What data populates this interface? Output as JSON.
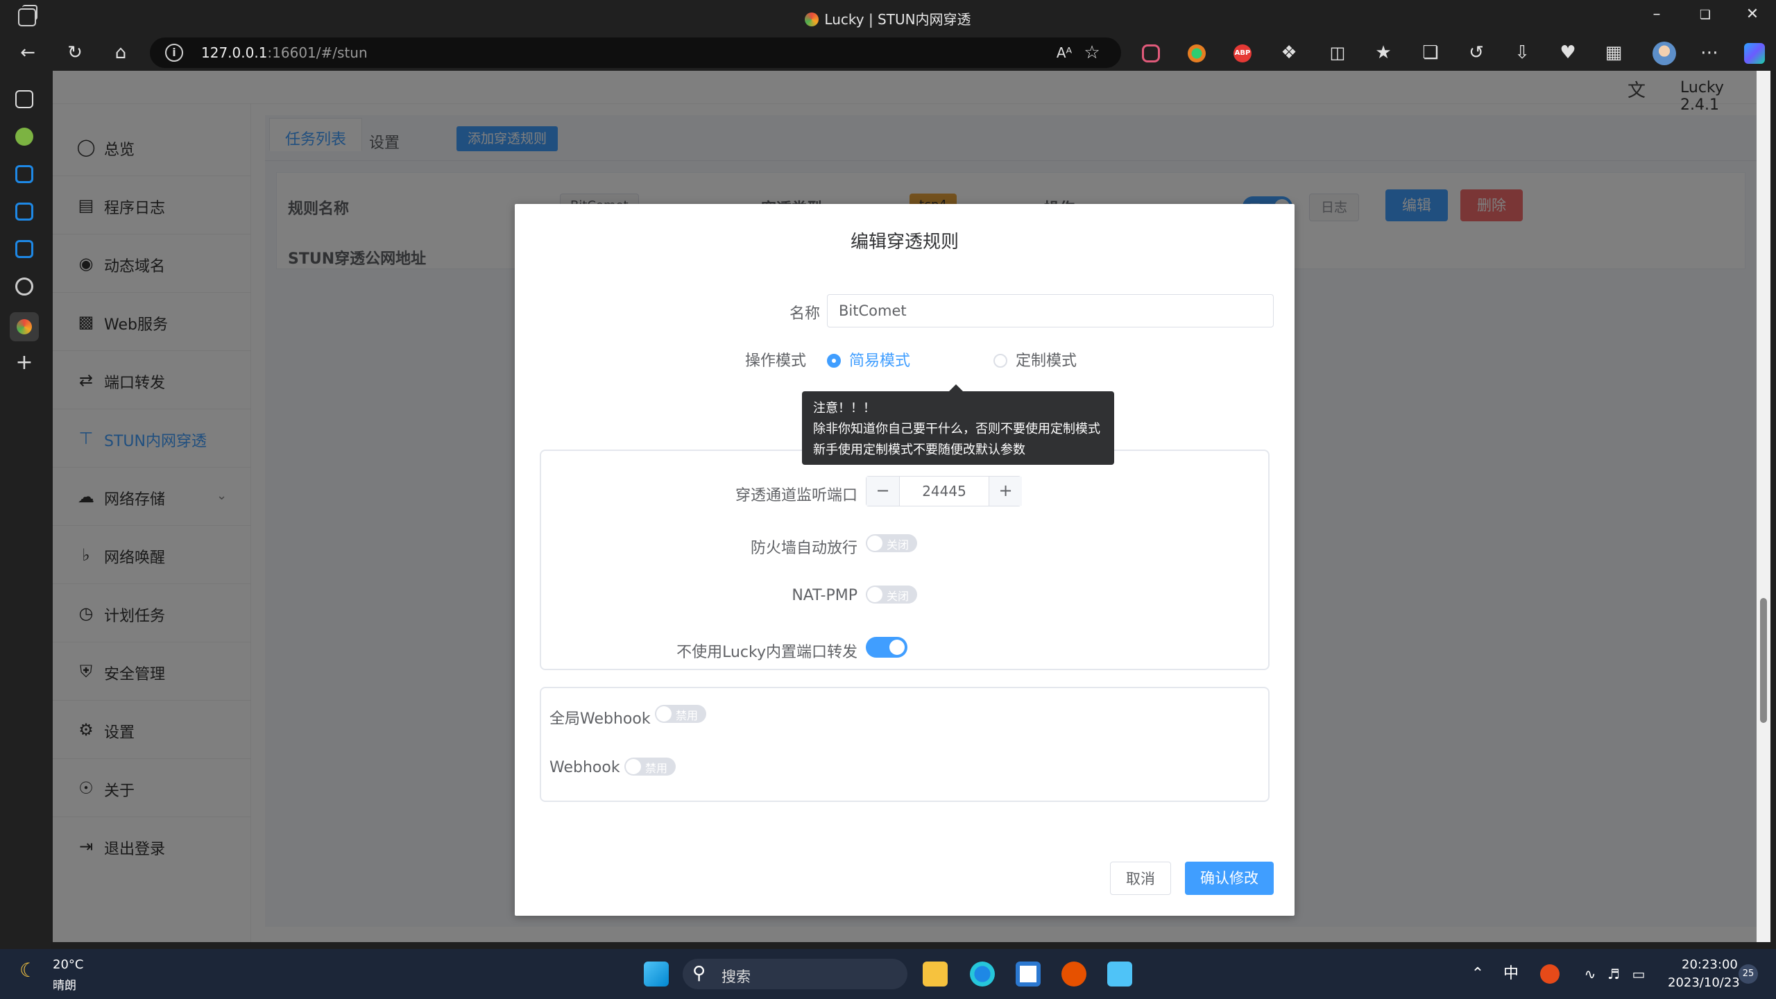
{
  "window": {
    "title": "Lucky | STUN内网穿透"
  },
  "browser": {
    "url_host": "127.0.0.1",
    "url_rest": ":16601/#/stun",
    "read_aloud_label": "Aᴬ"
  },
  "header": {
    "version": "Lucky 2.4.1"
  },
  "sidebar": {
    "items": [
      {
        "label": "总览",
        "icon": "dashboard-icon"
      },
      {
        "label": "程序日志",
        "icon": "log-icon"
      },
      {
        "label": "动态域名",
        "icon": "dns-icon"
      },
      {
        "label": "Web服务",
        "icon": "web-icon"
      },
      {
        "label": "端口转发",
        "icon": "port-forward-icon"
      },
      {
        "label": "STUN内网穿透",
        "icon": "stun-icon",
        "active": true
      },
      {
        "label": "网络存储",
        "icon": "cloud-icon"
      },
      {
        "label": "网络唤醒",
        "icon": "bell-icon"
      },
      {
        "label": "计划任务",
        "icon": "clock-icon"
      },
      {
        "label": "安全管理",
        "icon": "shield-icon"
      },
      {
        "label": "设置",
        "icon": "gear-icon"
      },
      {
        "label": "关于",
        "icon": "about-icon"
      },
      {
        "label": "退出登录",
        "icon": "logout-icon"
      }
    ]
  },
  "main": {
    "tabs": [
      "任务列表",
      "设置"
    ],
    "add_rule": "添加穿透规则",
    "rule": {
      "name_label": "规则名称",
      "name_value": "BitComet",
      "type_label": "穿透类型",
      "type_value": "tcp4",
      "ops_label": "操作",
      "switch_on_text": "开",
      "log_btn": "日志",
      "edit_btn": "编辑",
      "delete_btn": "删除",
      "public_addr_label": "STUN穿透公网地址"
    }
  },
  "dialog": {
    "title": "编辑穿透规则",
    "name_label": "名称",
    "name_value": "BitComet",
    "mode_label": "操作模式",
    "mode_simple": "简易模式",
    "mode_custom": "定制模式",
    "tooltip": {
      "line1": "注意！！！",
      "line2": "除非你知道你自己要干什么，否则不要使用定制模式",
      "line3": "新手使用定制模式不要随便改默认参数"
    },
    "listen_port_label": "穿透通道监听端口",
    "listen_port_value": "24445",
    "firewall_label": "防火墙自动放行",
    "natpmp_label": "NAT-PMP",
    "no_builtin_forward_label": "不使用Lucky内置端口转发",
    "switch_off_text": "关闭",
    "global_webhook_label": "全局Webhook",
    "webhook_label": "Webhook",
    "disabled_text": "禁用",
    "cancel": "取消",
    "confirm": "确认修改",
    "toggles": {
      "firewall": false,
      "natpmp": false,
      "no_builtin_forward": true,
      "global_webhook": false,
      "webhook": false
    }
  },
  "taskbar": {
    "temp": "20°C",
    "weather": "晴朗",
    "search": "搜索",
    "ime": "中",
    "time": "20:23:00",
    "date": "2023/10/23",
    "notification_count": "25"
  },
  "colors": {
    "accent": "#409eff",
    "danger": "#f56c6c",
    "tag_orange": "#e6a23c"
  }
}
